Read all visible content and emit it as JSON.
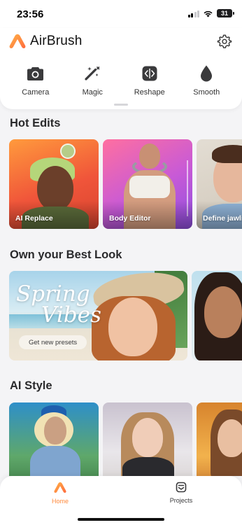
{
  "status_bar": {
    "time": "23:56",
    "battery": "31"
  },
  "app": {
    "name": "AirBrush",
    "accent": "#ff8a3d"
  },
  "tools": [
    {
      "label": "Camera",
      "icon": "camera-icon"
    },
    {
      "label": "Magic",
      "icon": "magic-wand-icon"
    },
    {
      "label": "Reshape",
      "icon": "reshape-icon"
    },
    {
      "label": "Smooth",
      "icon": "droplet-icon"
    }
  ],
  "sections": {
    "hot_edits": {
      "title": "Hot Edits",
      "cards": [
        {
          "label": "AI Replace"
        },
        {
          "label": "Body Editor"
        },
        {
          "label": "Define jawline"
        }
      ]
    },
    "best_look": {
      "title": "Own your Best Look",
      "banner": {
        "title_line1": "Spring",
        "title_line2": "Vibes",
        "button": "Get new presets"
      }
    },
    "ai_style": {
      "title": "AI Style"
    }
  },
  "bottom_nav": [
    {
      "label": "Home",
      "icon": "airbrush-home-icon",
      "active": true
    },
    {
      "label": "Projects",
      "icon": "projects-icon",
      "active": false
    }
  ]
}
